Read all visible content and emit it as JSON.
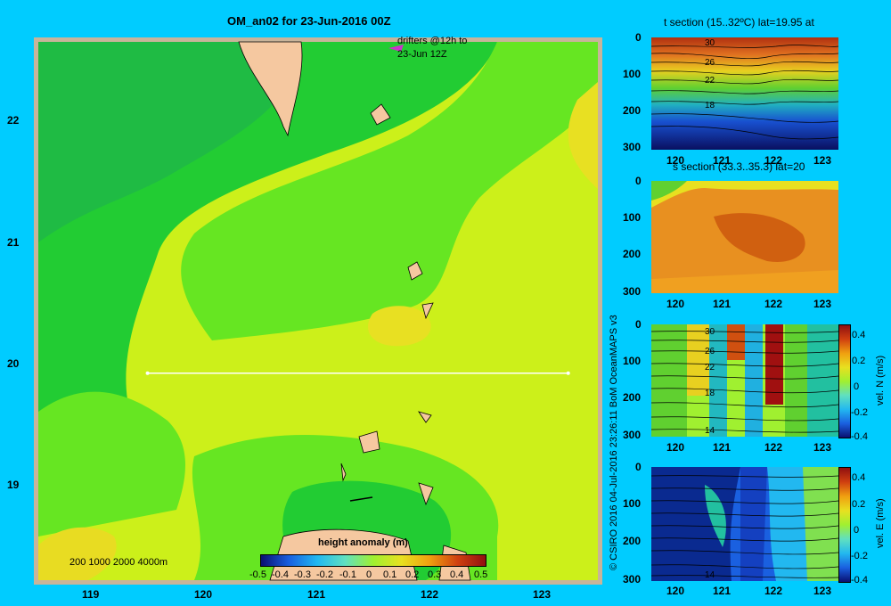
{
  "main_map": {
    "title": "OM_an02 for 23-Jun-2016 00Z",
    "drifter_note_line1": "drifters @12h to",
    "drifter_note_line2": "23-Jun 12Z",
    "depth_legend": "200 1000 2000 4000m",
    "colorbar_title": "height anomaly (m)",
    "colorbar_ticks": [
      "-0.5",
      "-0.4",
      "-0.3",
      "-0.2",
      "-0.1",
      "0",
      "0.1",
      "0.2",
      "0.3",
      "0.4",
      "0.5"
    ],
    "x_ticks": [
      "119",
      "120",
      "121",
      "122",
      "123"
    ],
    "y_ticks": [
      "22",
      "21",
      "20",
      "19"
    ],
    "section_line": {
      "lon_start": 119.5,
      "lon_end": 123.2,
      "lat": 20.0
    }
  },
  "credit": "© CSIRO 2016   04-Jul-2016 23:26:11 BoM OceanMAPS v3",
  "panels": [
    {
      "id": "t",
      "title": "t section (15..32ºC) lat=19.95 at",
      "y_ticks": [
        "0",
        "100",
        "200",
        "300"
      ],
      "x_ticks": [
        "120",
        "121",
        "122",
        "123"
      ],
      "contour_labels": [
        "30",
        "26",
        "22",
        "18"
      ]
    },
    {
      "id": "s",
      "title": "s section (33.3..35.3) lat=20",
      "y_ticks": [
        "0",
        "100",
        "200",
        "300"
      ],
      "x_ticks": [
        "120",
        "121",
        "122",
        "123"
      ],
      "contour_labels": []
    },
    {
      "id": "vn",
      "title": "",
      "y_ticks": [
        "0",
        "100",
        "200",
        "300"
      ],
      "x_ticks": [
        "120",
        "121",
        "122",
        "123"
      ],
      "contour_labels": [
        "30",
        "26",
        "22",
        "18",
        "14"
      ],
      "colorbar_label": "vel. N (m/s)",
      "colorbar_ticks": [
        "0.4",
        "0.2",
        "0",
        "-0.2",
        "-0.4"
      ]
    },
    {
      "id": "ve",
      "title": "",
      "y_ticks": [
        "0",
        "100",
        "200",
        "300"
      ],
      "x_ticks": [
        "120",
        "121",
        "122",
        "123"
      ],
      "contour_labels": [
        "14"
      ],
      "colorbar_label": "vel. E (m/s)",
      "colorbar_ticks": [
        "0.4",
        "0.2",
        "0",
        "-0.2",
        "-0.4"
      ]
    }
  ],
  "chart_data": [
    {
      "type": "heatmap",
      "title": "OM_an02 for 23-Jun-2016 00Z",
      "xlabel": "",
      "ylabel": "",
      "xlim": [
        118.5,
        123.5
      ],
      "ylim": [
        18.3,
        22.7
      ],
      "x_ticks": [
        119,
        120,
        121,
        122,
        123
      ],
      "y_ticks": [
        19,
        20,
        21,
        22
      ],
      "colorbar": {
        "label": "height anomaly (m)",
        "range": [
          -0.5,
          0.5
        ]
      },
      "field_summary": {
        "west_and_north": 0.05,
        "central_band": 0.15,
        "south_center": 0.05,
        "east_edge": 0.2
      }
    },
    {
      "type": "heatmap",
      "title": "t section (15..32ºC) lat=19.95 at",
      "xlim": [
        119.6,
        123.2
      ],
      "ylim": [
        300,
        0
      ],
      "value_range": [
        15,
        32
      ]
    },
    {
      "type": "heatmap",
      "title": "s section (33.3..35.3) lat=20",
      "xlim": [
        119.6,
        123.2
      ],
      "ylim": [
        300,
        0
      ],
      "value_range": [
        33.3,
        35.3
      ]
    },
    {
      "type": "heatmap",
      "title": "",
      "xlim": [
        119.6,
        123.2
      ],
      "ylim": [
        300,
        0
      ],
      "colorbar": {
        "label": "vel. N (m/s)",
        "range": [
          -0.4,
          0.4
        ]
      }
    },
    {
      "type": "heatmap",
      "title": "",
      "xlim": [
        119.6,
        123.2
      ],
      "ylim": [
        300,
        0
      ],
      "colorbar": {
        "label": "vel. E (m/s)",
        "range": [
          -0.4,
          0.4
        ]
      }
    }
  ]
}
